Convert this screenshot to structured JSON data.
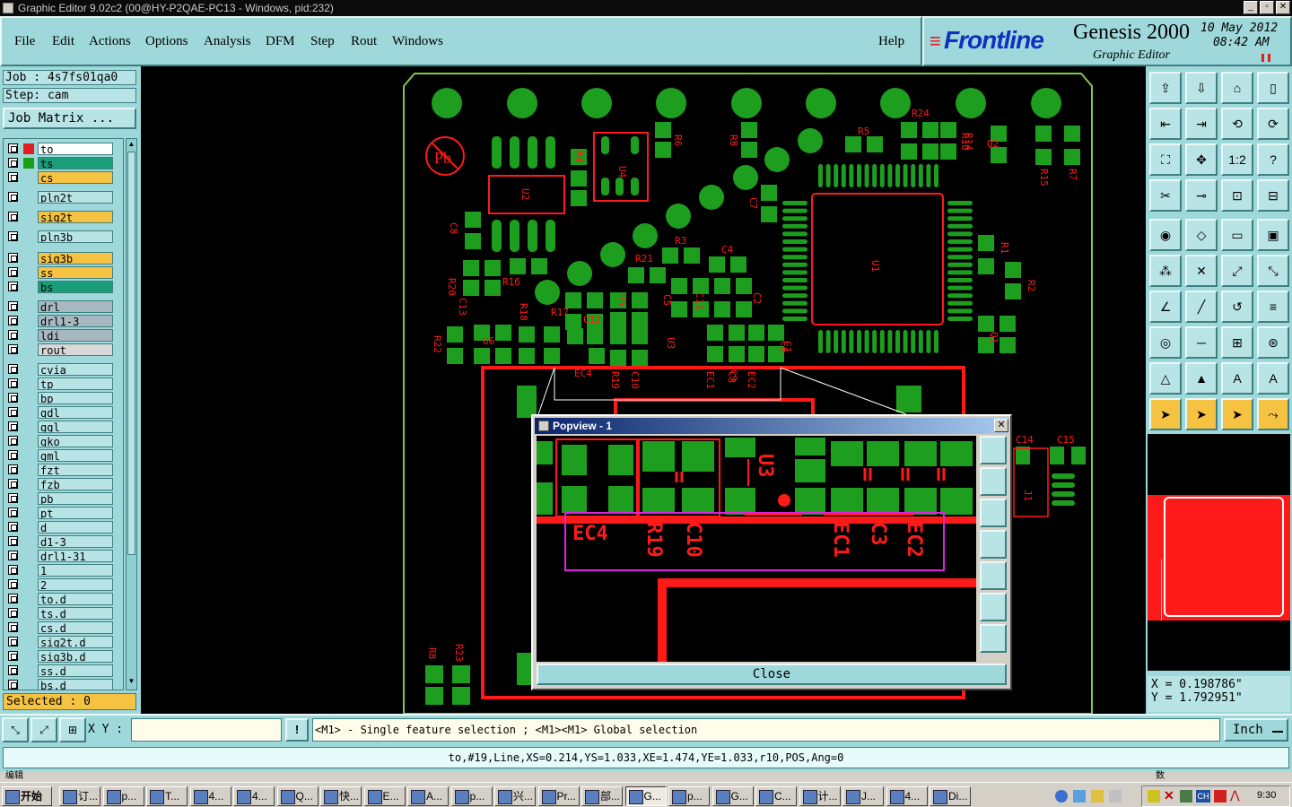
{
  "window": {
    "title": "Graphic Editor 9.02c2 (00@HY-P2QAE-PC13 - Windows, pid:232)"
  },
  "menu": [
    "File",
    "Edit",
    "Actions",
    "Options",
    "Analysis",
    "DFM",
    "Step",
    "Rout",
    "Windows"
  ],
  "help": "Help",
  "brand": {
    "logo": "Frontline",
    "product": "Genesis 2000",
    "subtitle": "Graphic Editor",
    "date": "10 May 2012",
    "time": "08:42 AM"
  },
  "job": {
    "job": "Job : 4s7fs01qa0",
    "step": "Step: cam",
    "matrix_button": "Job Matrix ..."
  },
  "layers": [
    {
      "name": "to",
      "color": "#ffffff"
    },
    {
      "name": "ts",
      "color": "#1a9e7a"
    },
    {
      "name": "cs",
      "color": "#f5c242"
    },
    {
      "name": "pln2t",
      "color": "#b8e4e6"
    },
    {
      "name": "sig2t",
      "color": "#f5c242"
    },
    {
      "name": "pln3b",
      "color": "#b8e4e6"
    },
    {
      "name": "sig3b",
      "color": "#f5c242"
    },
    {
      "name": "ss",
      "color": "#f5c242"
    },
    {
      "name": "bs",
      "color": "#1a9e7a"
    },
    {
      "name": "drl",
      "color": "#a8b8c0"
    },
    {
      "name": "drl1-3",
      "color": "#a8b8c0"
    },
    {
      "name": "ldi",
      "color": "#a8b8c0"
    },
    {
      "name": "rout",
      "color": "#d8d8d8"
    },
    {
      "name": "cvia",
      "color": "#b8e4e6"
    },
    {
      "name": "tp",
      "color": "#b8e4e6"
    },
    {
      "name": "bp",
      "color": "#b8e4e6"
    },
    {
      "name": "gdl",
      "color": "#b8e4e6"
    },
    {
      "name": "ggl",
      "color": "#b8e4e6"
    },
    {
      "name": "gko",
      "color": "#b8e4e6"
    },
    {
      "name": "gml",
      "color": "#b8e4e6"
    },
    {
      "name": "fzt",
      "color": "#b8e4e6"
    },
    {
      "name": "fzb",
      "color": "#b8e4e6"
    },
    {
      "name": "pb",
      "color": "#b8e4e6"
    },
    {
      "name": "pt",
      "color": "#b8e4e6"
    },
    {
      "name": "d",
      "color": "#b8e4e6"
    },
    {
      "name": "d1-3",
      "color": "#b8e4e6"
    },
    {
      "name": "drl1-31",
      "color": "#b8e4e6"
    },
    {
      "name": "1",
      "color": "#b8e4e6"
    },
    {
      "name": "2",
      "color": "#b8e4e6"
    },
    {
      "name": "to.d",
      "color": "#b8e4e6"
    },
    {
      "name": "ts.d",
      "color": "#b8e4e6"
    },
    {
      "name": "cs.d",
      "color": "#b8e4e6"
    },
    {
      "name": "sig2t.d",
      "color": "#b8e4e6"
    },
    {
      "name": "sig3b.d",
      "color": "#b8e4e6"
    },
    {
      "name": "ss.d",
      "color": "#b8e4e6"
    },
    {
      "name": "bs.d",
      "color": "#b8e4e6"
    }
  ],
  "selected": "Selected : 0",
  "popview": {
    "title": "Popview - 1",
    "close_label": "Close",
    "labels": [
      "EC4",
      "R19",
      "C10",
      "U3",
      "EC1",
      "C3",
      "EC2"
    ]
  },
  "board_labels": [
    "U4",
    "U2",
    "R4",
    "R6",
    "R8",
    "R5",
    "R24",
    "R14",
    "Q2",
    "R15",
    "R7",
    "C7",
    "U1",
    "R3",
    "C4",
    "R21",
    "R1",
    "R2",
    "C2",
    "C5",
    "R20",
    "C8",
    "R18",
    "C11",
    "C6",
    "R16",
    "R17",
    "C12",
    "U5",
    "U6",
    "R22",
    "C9",
    "U3",
    "C1",
    "EC4",
    "R19",
    "C10",
    "EC1",
    "C3",
    "EC2",
    "C14",
    "C15",
    "J1",
    "R8",
    "R23",
    "Q1",
    "C13",
    "R10"
  ],
  "pb_mark": "Pb",
  "coords": {
    "x": "X = 0.198786\"",
    "y": "Y = 1.792951\""
  },
  "bottom": {
    "xy_label": "X Y :",
    "xy_value": "",
    "hint": "<M1> - Single feature selection ; <M1><M1> Global selection",
    "units": "Inch"
  },
  "status": "to,#19,Line,XS=0.214,YS=1.033,XE=1.474,YE=1.033,r10,POS,Ang=0",
  "status_left": "编辑",
  "status_right": "数",
  "taskbar": {
    "start": "开始",
    "tasks": [
      "订...",
      "p...",
      "T...",
      "4...",
      "4...",
      "Q...",
      "快...",
      "E...",
      "A...",
      "p...",
      "兴...",
      "Pr...",
      "部...",
      "G...",
      "p...",
      "G...",
      "C...",
      "计...",
      "J...",
      "4...",
      "Di..."
    ],
    "clock": "9:30"
  },
  "colors": {
    "pad": "#1e9e1e",
    "silk": "#ff1a1a",
    "outline": "#7ec850",
    "panel": "#9ed8da",
    "highlight": "#f5c242"
  }
}
